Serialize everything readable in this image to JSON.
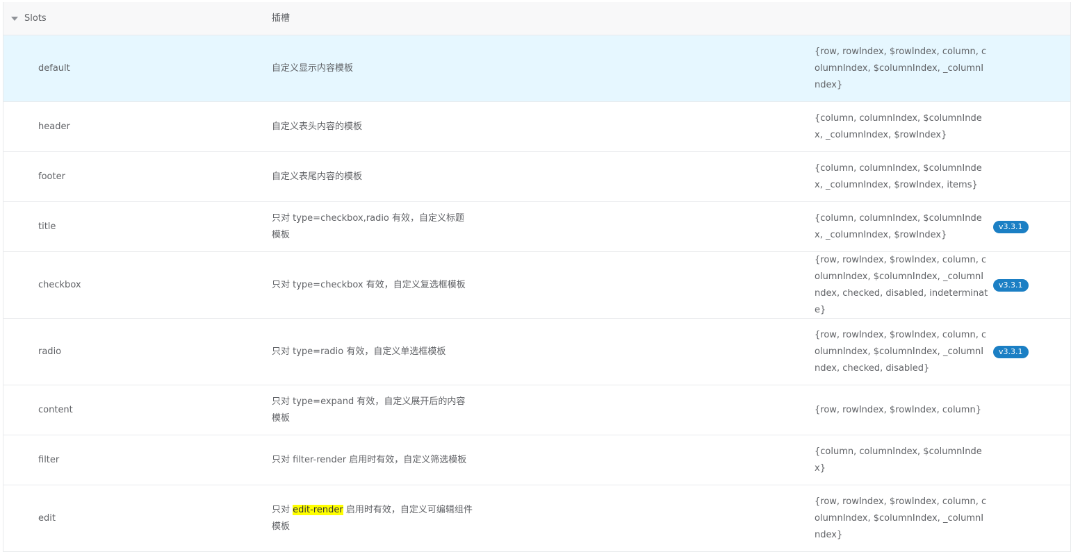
{
  "group": {
    "name": "Slots",
    "desc": "插槽"
  },
  "rows": [
    {
      "name": "default",
      "desc": "自定义显示内容模板",
      "params": "{row, rowIndex, $rowIndex, column, columnIndex, $columnIndex, _columnIndex}",
      "version": ""
    },
    {
      "name": "header",
      "desc": "自定义表头内容的模板",
      "params": "{column, columnIndex, $columnIndex, _columnIndex, $rowIndex}",
      "version": ""
    },
    {
      "name": "footer",
      "desc": "自定义表尾内容的模板",
      "params": "{column, columnIndex, $columnIndex, _columnIndex, $rowIndex, items}",
      "version": ""
    },
    {
      "name": "title",
      "desc": "只对 type=checkbox,radio 有效，自定义标题模板",
      "params": "{column, columnIndex, $columnIndex, _columnIndex, $rowIndex}",
      "version": "v3.3.1"
    },
    {
      "name": "checkbox",
      "desc": "只对 type=checkbox 有效，自定义复选框模板",
      "params": "{row, rowIndex, $rowIndex, column, columnIndex, $columnIndex, _columnIndex, checked, disabled, indeterminate}",
      "version": "v3.3.1"
    },
    {
      "name": "radio",
      "desc": "只对 type=radio 有效，自定义单选框模板",
      "params": "{row, rowIndex, $rowIndex, column, columnIndex, $columnIndex, _columnIndex, checked, disabled}",
      "version": "v3.3.1"
    },
    {
      "name": "content",
      "desc": "只对 type=expand 有效，自定义展开后的内容模板",
      "params": "{row, rowIndex, $rowIndex, column}",
      "version": ""
    },
    {
      "name": "filter",
      "desc": "只对 filter-render 启用时有效，自定义筛选模板",
      "params": "{column, columnIndex, $columnIndex}",
      "version": ""
    },
    {
      "name": "edit",
      "desc_prefix": "只对 ",
      "desc_highlight": "edit-render",
      "desc_suffix": " 启用时有效，自定义可编辑组件模板",
      "params": "{row, rowIndex, $rowIndex, column, columnIndex, $columnIndex, _columnIndex}",
      "version": ""
    }
  ],
  "colors": {
    "highlight": "#ffff00",
    "badge": "#1b7fc4",
    "active_row": "#e6f7ff",
    "group_row": "#f8f8f9"
  }
}
